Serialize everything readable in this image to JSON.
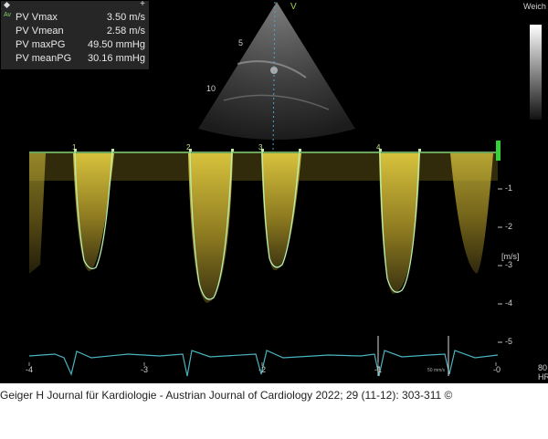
{
  "meas": {
    "plus_icon": "+",
    "av": "Av",
    "rows": [
      {
        "label": "PV Vmax",
        "value": "3.50 m/s"
      },
      {
        "label": "PV Vmean",
        "value": "2.58 m/s"
      },
      {
        "label": "PV maxPG",
        "value": "49.50 mmHg"
      },
      {
        "label": "PV meanPG",
        "value": "30.16 mmHg"
      }
    ]
  },
  "image": {
    "v_marker": "V",
    "depth_marks": [
      "5",
      "10"
    ],
    "weich": "Weich",
    "cycle_labels": [
      "1",
      "2",
      "3",
      "4"
    ],
    "velocity_ticks": [
      "-1",
      "-2",
      "-3",
      "-4",
      "-5"
    ],
    "velocity_unit": "[m/s]",
    "time_ticks": [
      "-4",
      "-3",
      "-2",
      "-1",
      "-0"
    ],
    "sweep_label": "50 mm/s",
    "hr_value": "80",
    "hr_label": "HR"
  },
  "caption": "Geiger H Journal für Kardiologie - Austrian Journal of Cardiology 2022; 29 (11-12): 303-311 ©"
}
